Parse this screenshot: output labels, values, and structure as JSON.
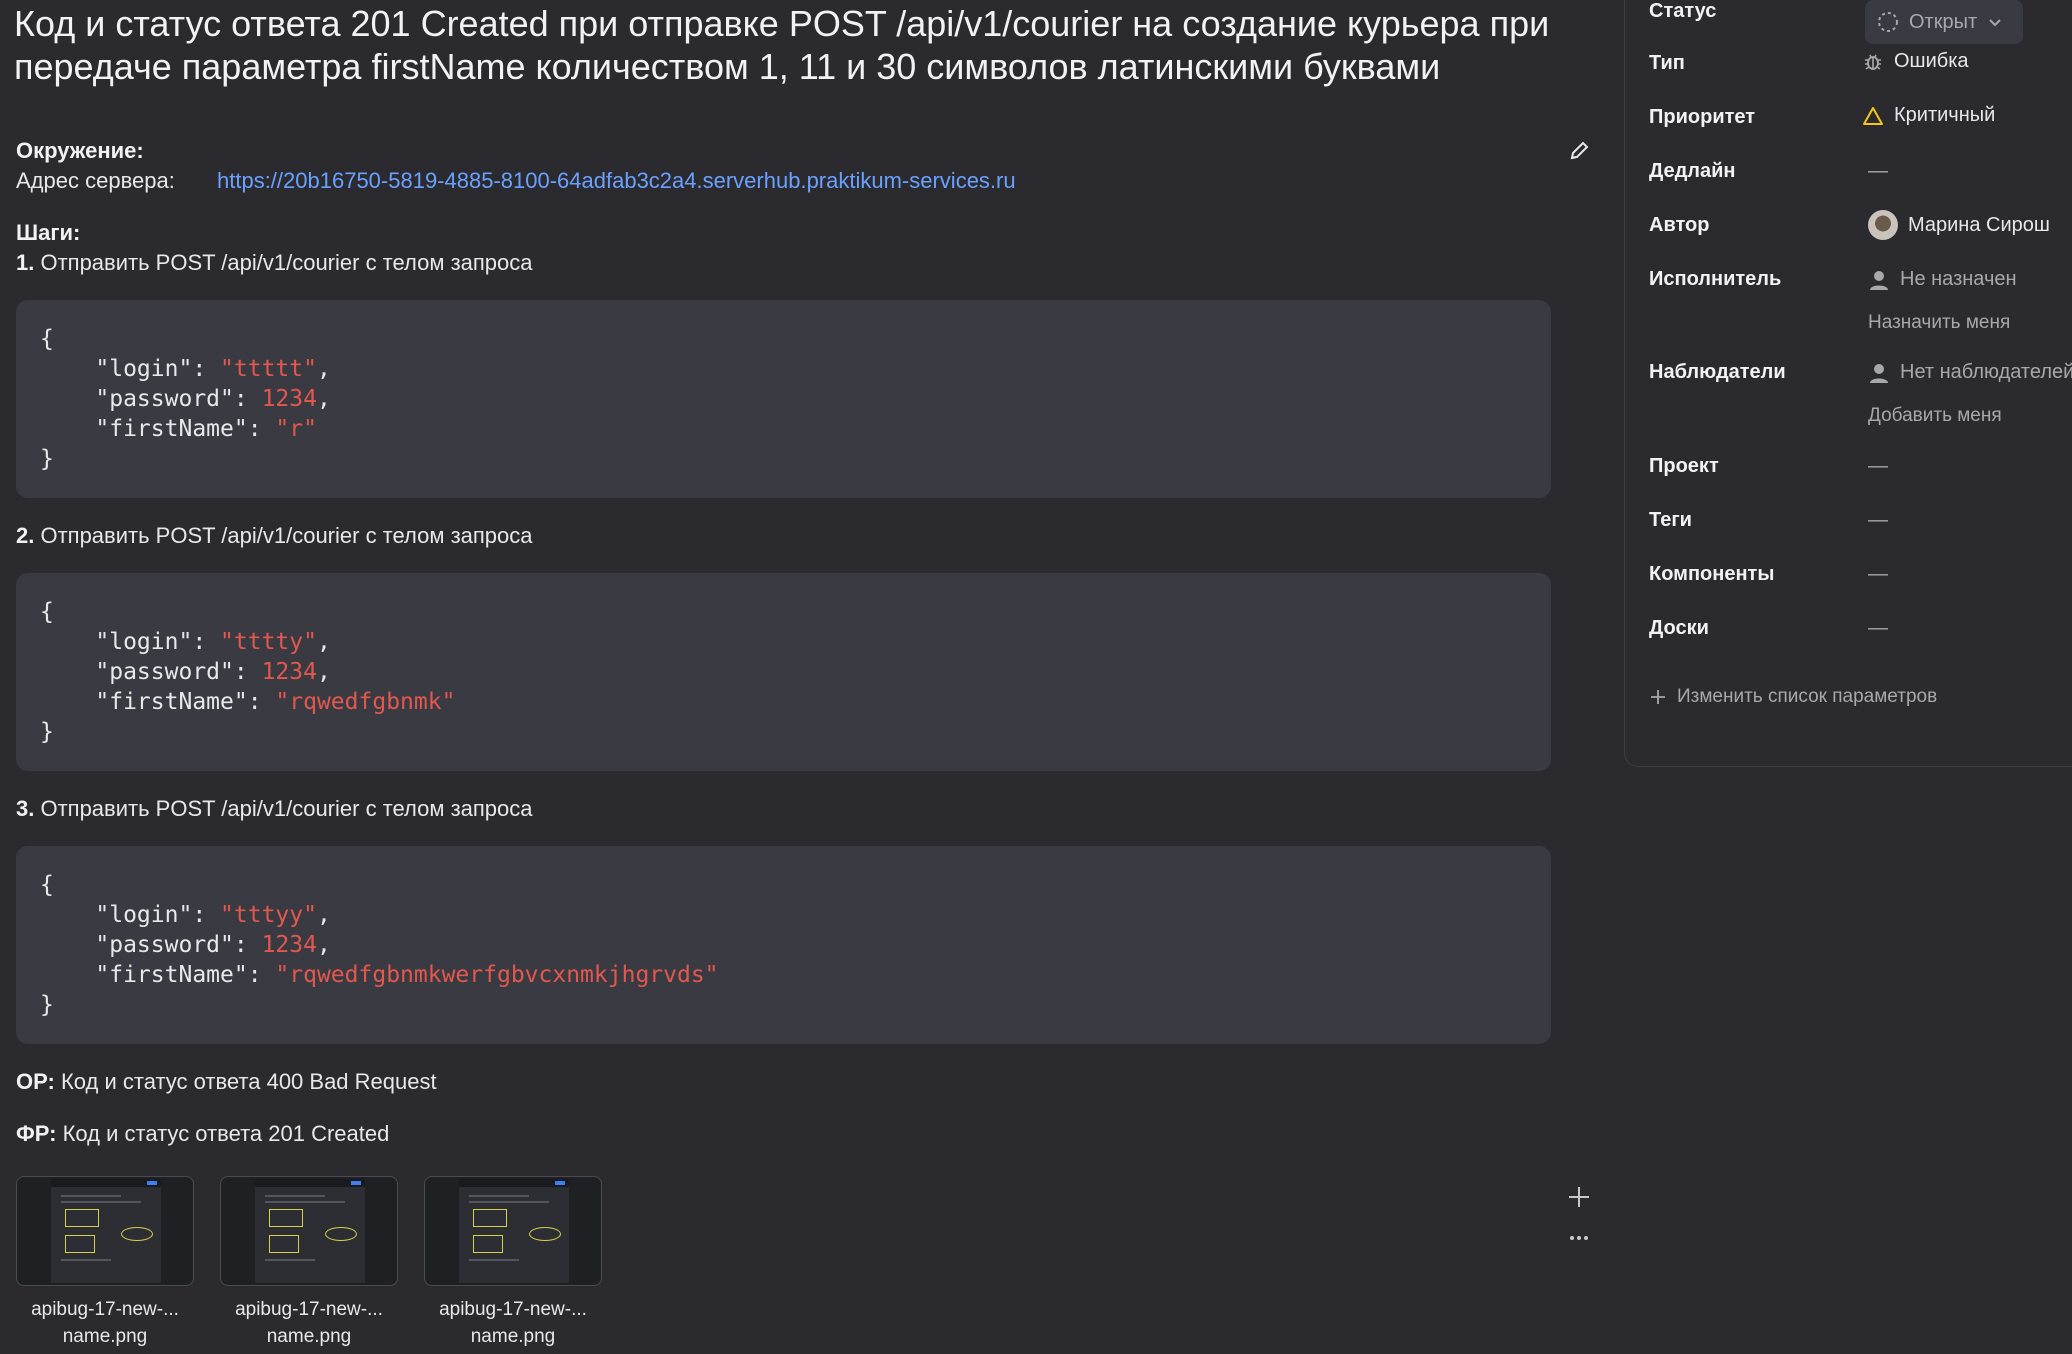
{
  "issue": {
    "title": "Код и статус ответа 201 Created при отправке POST /api/v1/courier на создание курьера при передаче параметра firstName количеством 1, 11 и 30 символов латинскими буквами"
  },
  "env": {
    "heading": "Окружение:",
    "server_label": "Адрес сервера:",
    "server_url": "https://20b16750-5819-4885-8100-64adfab3c2a4.serverhub.praktikum-services.ru"
  },
  "steps": {
    "heading": "Шаги:",
    "items": [
      {
        "num": "1.",
        "text": " Отправить POST /api/v1/courier с телом запроса",
        "login": "\"ttttt\"",
        "password": "1234",
        "firstName": "\"r\""
      },
      {
        "num": "2.",
        "text": " Отправить POST /api/v1/courier с телом запроса",
        "login": "\"tttty\"",
        "password": "1234",
        "firstName": "\"rqwedfgbnmk\""
      },
      {
        "num": "3.",
        "text": " Отправить POST /api/v1/courier с телом запроса",
        "login": "\"tttyy\"",
        "password": "1234",
        "firstName": "\"rqwedfgbnmkwerfgbvcxnmkjhgrvds\""
      }
    ],
    "keys": {
      "login": "\"login\"",
      "password": "\"password\"",
      "firstName": "\"firstName\""
    }
  },
  "expected": {
    "label": "ОР:",
    "text": " Код и статус ответа 400 Bad Request"
  },
  "actual": {
    "label": "ФР:",
    "text": " Код и статус ответа 201 Created"
  },
  "attachments": [
    {
      "line1": "apibug-17-new-...",
      "line2": "name.png"
    },
    {
      "line1": "apibug-17-new-...",
      "line2": "name.png"
    },
    {
      "line1": "apibug-17-new-...",
      "line2": "name.png"
    }
  ],
  "sidebar": {
    "status": {
      "key": "Статус",
      "value": "Открыт"
    },
    "type": {
      "key": "Тип",
      "value": "Ошибка"
    },
    "priority": {
      "key": "Приоритет",
      "value": "Критичный"
    },
    "deadline": {
      "key": "Дедлайн",
      "value": "—"
    },
    "author": {
      "key": "Автор",
      "value": "Марина Сирош"
    },
    "assignee": {
      "key": "Исполнитель",
      "value": "Не назначен",
      "action": "Назначить меня"
    },
    "watchers": {
      "key": "Наблюдатели",
      "value": "Нет наблюдателей",
      "action": "Добавить меня"
    },
    "project": {
      "key": "Проект",
      "value": "—"
    },
    "tags": {
      "key": "Теги",
      "value": "—"
    },
    "components": {
      "key": "Компоненты",
      "value": "—"
    },
    "boards": {
      "key": "Доски",
      "value": "—"
    },
    "edit_params": "Изменить список параметров"
  },
  "colors": {
    "background": "#2b2b2f",
    "code_bg": "#3a3b42",
    "link": "#6aa1ff",
    "string": "#e2584f",
    "warning": "#f5c518"
  }
}
